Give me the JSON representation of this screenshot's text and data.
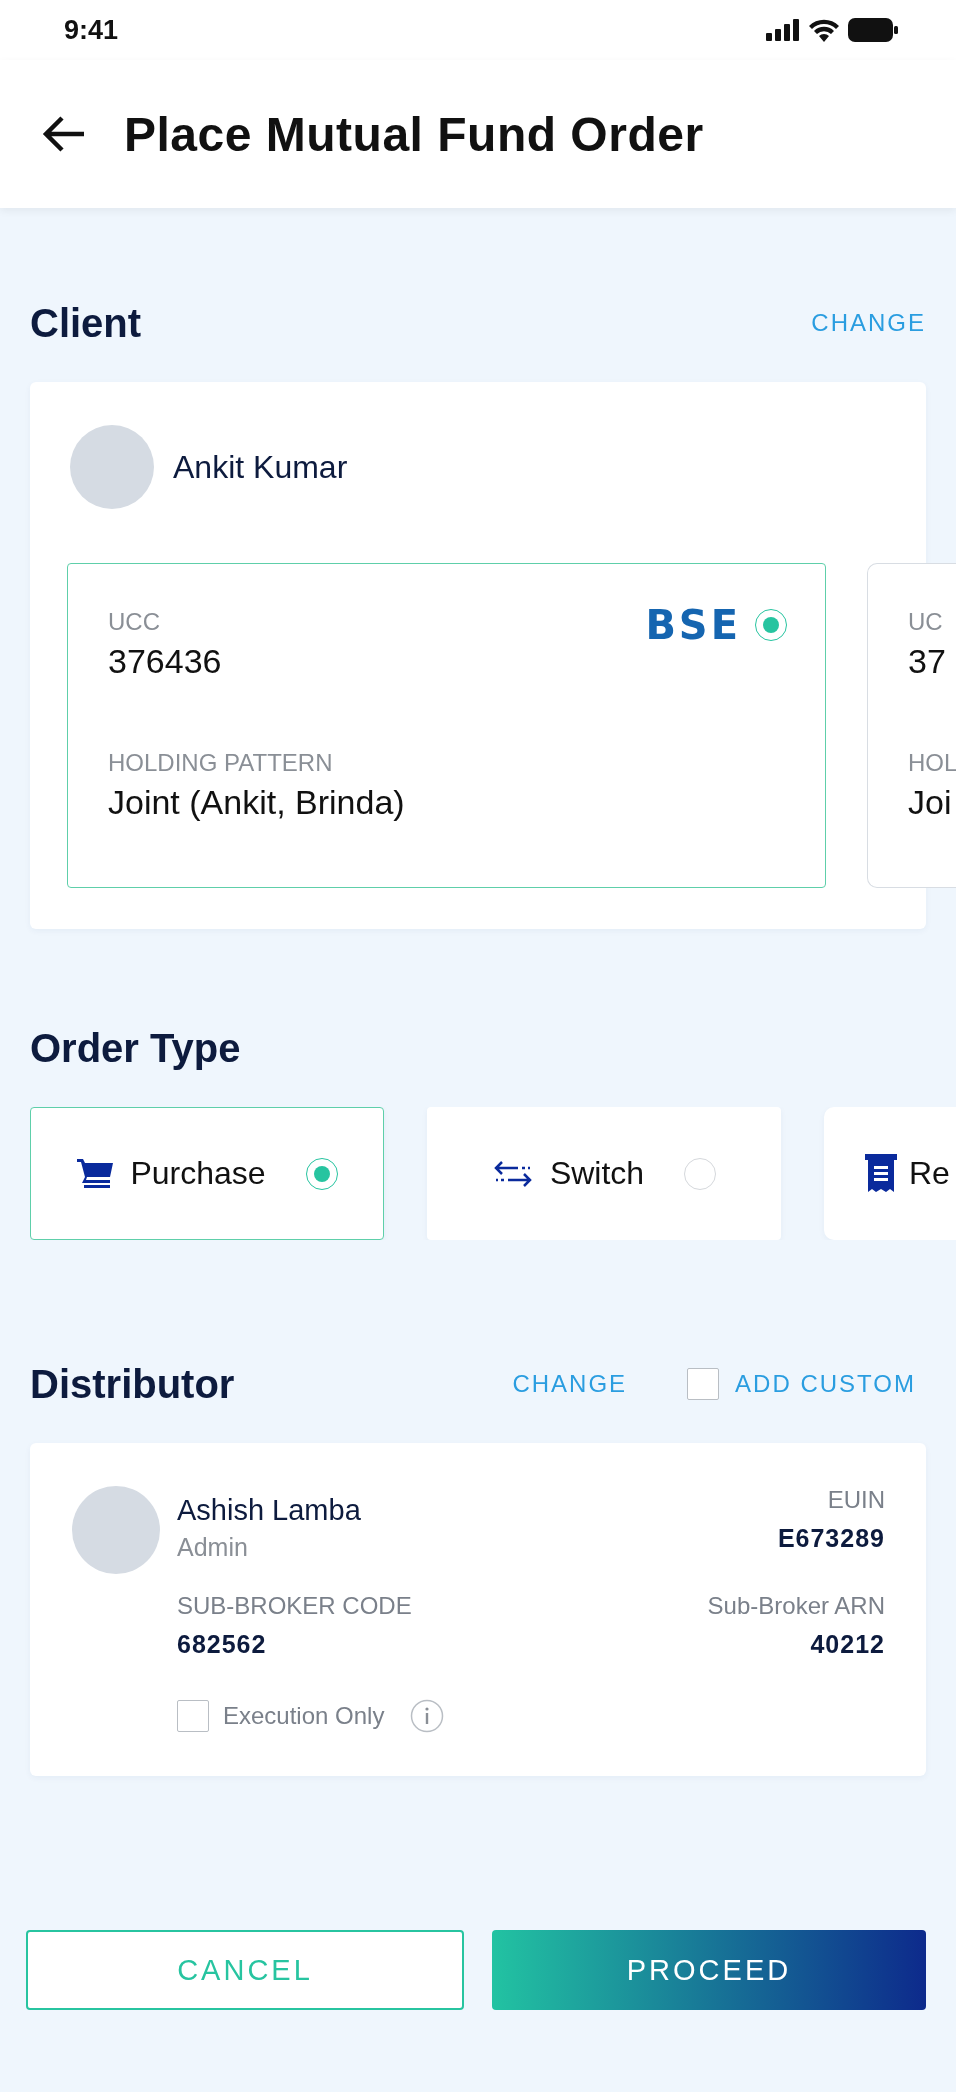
{
  "status_bar": {
    "time": "9:41"
  },
  "header": {
    "title": "Place Mutual Fund Order"
  },
  "client": {
    "heading": "Client",
    "action": "CHANGE",
    "name": "Ankit Kumar",
    "accounts": [
      {
        "selected": true,
        "exchange": "BSE",
        "fields": [
          {
            "label": "UCC",
            "value": "376436"
          },
          {
            "label": "HOLDING PATTERN",
            "value": "Joint (Ankit, Brinda)"
          }
        ]
      },
      {
        "selected": false,
        "fields": [
          {
            "label": "UC",
            "value": "37"
          },
          {
            "label": "HOL",
            "value": "Joi"
          }
        ]
      }
    ]
  },
  "order_type": {
    "heading": "Order Type",
    "options": [
      {
        "kind": "cart",
        "label": "Purchase",
        "selected": true
      },
      {
        "kind": "switch",
        "label": "Switch",
        "selected": false
      },
      {
        "kind": "receipt",
        "label": "Re",
        "selected": false
      }
    ]
  },
  "distributor": {
    "heading": "Distributor",
    "action": "CHANGE",
    "add_custom": {
      "label": "ADD CUSTOM",
      "checked": false
    },
    "name": "Ashish Lamba",
    "role": "Admin",
    "euin": {
      "label": "EUIN",
      "value": "E673289"
    },
    "sub_broker_code": {
      "label": "SUB-BROKER CODE",
      "value": "682562"
    },
    "sub_broker_arn": {
      "label": "Sub-Broker ARN",
      "value": "40212"
    },
    "execution_only": {
      "label": "Execution Only",
      "checked": false
    }
  },
  "buttons": [
    {
      "kind": "outline",
      "label": "CANCEL"
    },
    {
      "kind": "primary",
      "label": "PROCEED"
    }
  ]
}
